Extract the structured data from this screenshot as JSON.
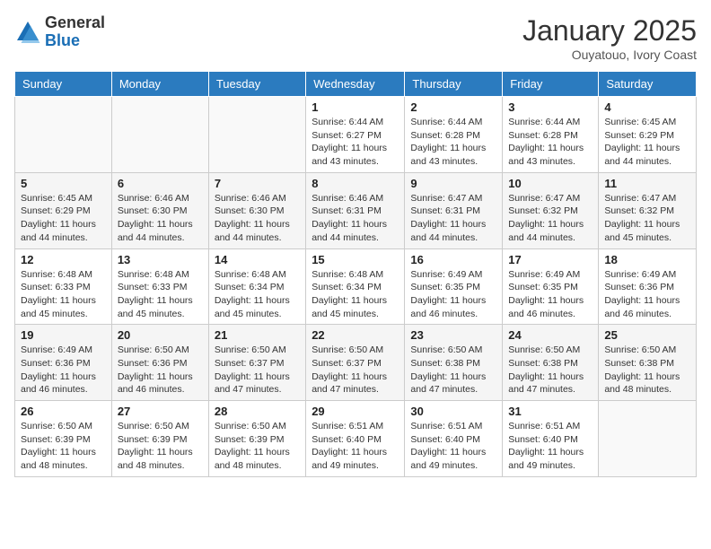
{
  "header": {
    "logo_general": "General",
    "logo_blue": "Blue",
    "month_title": "January 2025",
    "location": "Ouyatouo, Ivory Coast"
  },
  "days_of_week": [
    "Sunday",
    "Monday",
    "Tuesday",
    "Wednesday",
    "Thursday",
    "Friday",
    "Saturday"
  ],
  "weeks": [
    [
      {
        "day": "",
        "info": ""
      },
      {
        "day": "",
        "info": ""
      },
      {
        "day": "",
        "info": ""
      },
      {
        "day": "1",
        "info": "Sunrise: 6:44 AM\nSunset: 6:27 PM\nDaylight: 11 hours and 43 minutes."
      },
      {
        "day": "2",
        "info": "Sunrise: 6:44 AM\nSunset: 6:28 PM\nDaylight: 11 hours and 43 minutes."
      },
      {
        "day": "3",
        "info": "Sunrise: 6:44 AM\nSunset: 6:28 PM\nDaylight: 11 hours and 43 minutes."
      },
      {
        "day": "4",
        "info": "Sunrise: 6:45 AM\nSunset: 6:29 PM\nDaylight: 11 hours and 44 minutes."
      }
    ],
    [
      {
        "day": "5",
        "info": "Sunrise: 6:45 AM\nSunset: 6:29 PM\nDaylight: 11 hours and 44 minutes."
      },
      {
        "day": "6",
        "info": "Sunrise: 6:46 AM\nSunset: 6:30 PM\nDaylight: 11 hours and 44 minutes."
      },
      {
        "day": "7",
        "info": "Sunrise: 6:46 AM\nSunset: 6:30 PM\nDaylight: 11 hours and 44 minutes."
      },
      {
        "day": "8",
        "info": "Sunrise: 6:46 AM\nSunset: 6:31 PM\nDaylight: 11 hours and 44 minutes."
      },
      {
        "day": "9",
        "info": "Sunrise: 6:47 AM\nSunset: 6:31 PM\nDaylight: 11 hours and 44 minutes."
      },
      {
        "day": "10",
        "info": "Sunrise: 6:47 AM\nSunset: 6:32 PM\nDaylight: 11 hours and 44 minutes."
      },
      {
        "day": "11",
        "info": "Sunrise: 6:47 AM\nSunset: 6:32 PM\nDaylight: 11 hours and 45 minutes."
      }
    ],
    [
      {
        "day": "12",
        "info": "Sunrise: 6:48 AM\nSunset: 6:33 PM\nDaylight: 11 hours and 45 minutes."
      },
      {
        "day": "13",
        "info": "Sunrise: 6:48 AM\nSunset: 6:33 PM\nDaylight: 11 hours and 45 minutes."
      },
      {
        "day": "14",
        "info": "Sunrise: 6:48 AM\nSunset: 6:34 PM\nDaylight: 11 hours and 45 minutes."
      },
      {
        "day": "15",
        "info": "Sunrise: 6:48 AM\nSunset: 6:34 PM\nDaylight: 11 hours and 45 minutes."
      },
      {
        "day": "16",
        "info": "Sunrise: 6:49 AM\nSunset: 6:35 PM\nDaylight: 11 hours and 46 minutes."
      },
      {
        "day": "17",
        "info": "Sunrise: 6:49 AM\nSunset: 6:35 PM\nDaylight: 11 hours and 46 minutes."
      },
      {
        "day": "18",
        "info": "Sunrise: 6:49 AM\nSunset: 6:36 PM\nDaylight: 11 hours and 46 minutes."
      }
    ],
    [
      {
        "day": "19",
        "info": "Sunrise: 6:49 AM\nSunset: 6:36 PM\nDaylight: 11 hours and 46 minutes."
      },
      {
        "day": "20",
        "info": "Sunrise: 6:50 AM\nSunset: 6:36 PM\nDaylight: 11 hours and 46 minutes."
      },
      {
        "day": "21",
        "info": "Sunrise: 6:50 AM\nSunset: 6:37 PM\nDaylight: 11 hours and 47 minutes."
      },
      {
        "day": "22",
        "info": "Sunrise: 6:50 AM\nSunset: 6:37 PM\nDaylight: 11 hours and 47 minutes."
      },
      {
        "day": "23",
        "info": "Sunrise: 6:50 AM\nSunset: 6:38 PM\nDaylight: 11 hours and 47 minutes."
      },
      {
        "day": "24",
        "info": "Sunrise: 6:50 AM\nSunset: 6:38 PM\nDaylight: 11 hours and 47 minutes."
      },
      {
        "day": "25",
        "info": "Sunrise: 6:50 AM\nSunset: 6:38 PM\nDaylight: 11 hours and 48 minutes."
      }
    ],
    [
      {
        "day": "26",
        "info": "Sunrise: 6:50 AM\nSunset: 6:39 PM\nDaylight: 11 hours and 48 minutes."
      },
      {
        "day": "27",
        "info": "Sunrise: 6:50 AM\nSunset: 6:39 PM\nDaylight: 11 hours and 48 minutes."
      },
      {
        "day": "28",
        "info": "Sunrise: 6:50 AM\nSunset: 6:39 PM\nDaylight: 11 hours and 48 minutes."
      },
      {
        "day": "29",
        "info": "Sunrise: 6:51 AM\nSunset: 6:40 PM\nDaylight: 11 hours and 49 minutes."
      },
      {
        "day": "30",
        "info": "Sunrise: 6:51 AM\nSunset: 6:40 PM\nDaylight: 11 hours and 49 minutes."
      },
      {
        "day": "31",
        "info": "Sunrise: 6:51 AM\nSunset: 6:40 PM\nDaylight: 11 hours and 49 minutes."
      },
      {
        "day": "",
        "info": ""
      }
    ]
  ]
}
